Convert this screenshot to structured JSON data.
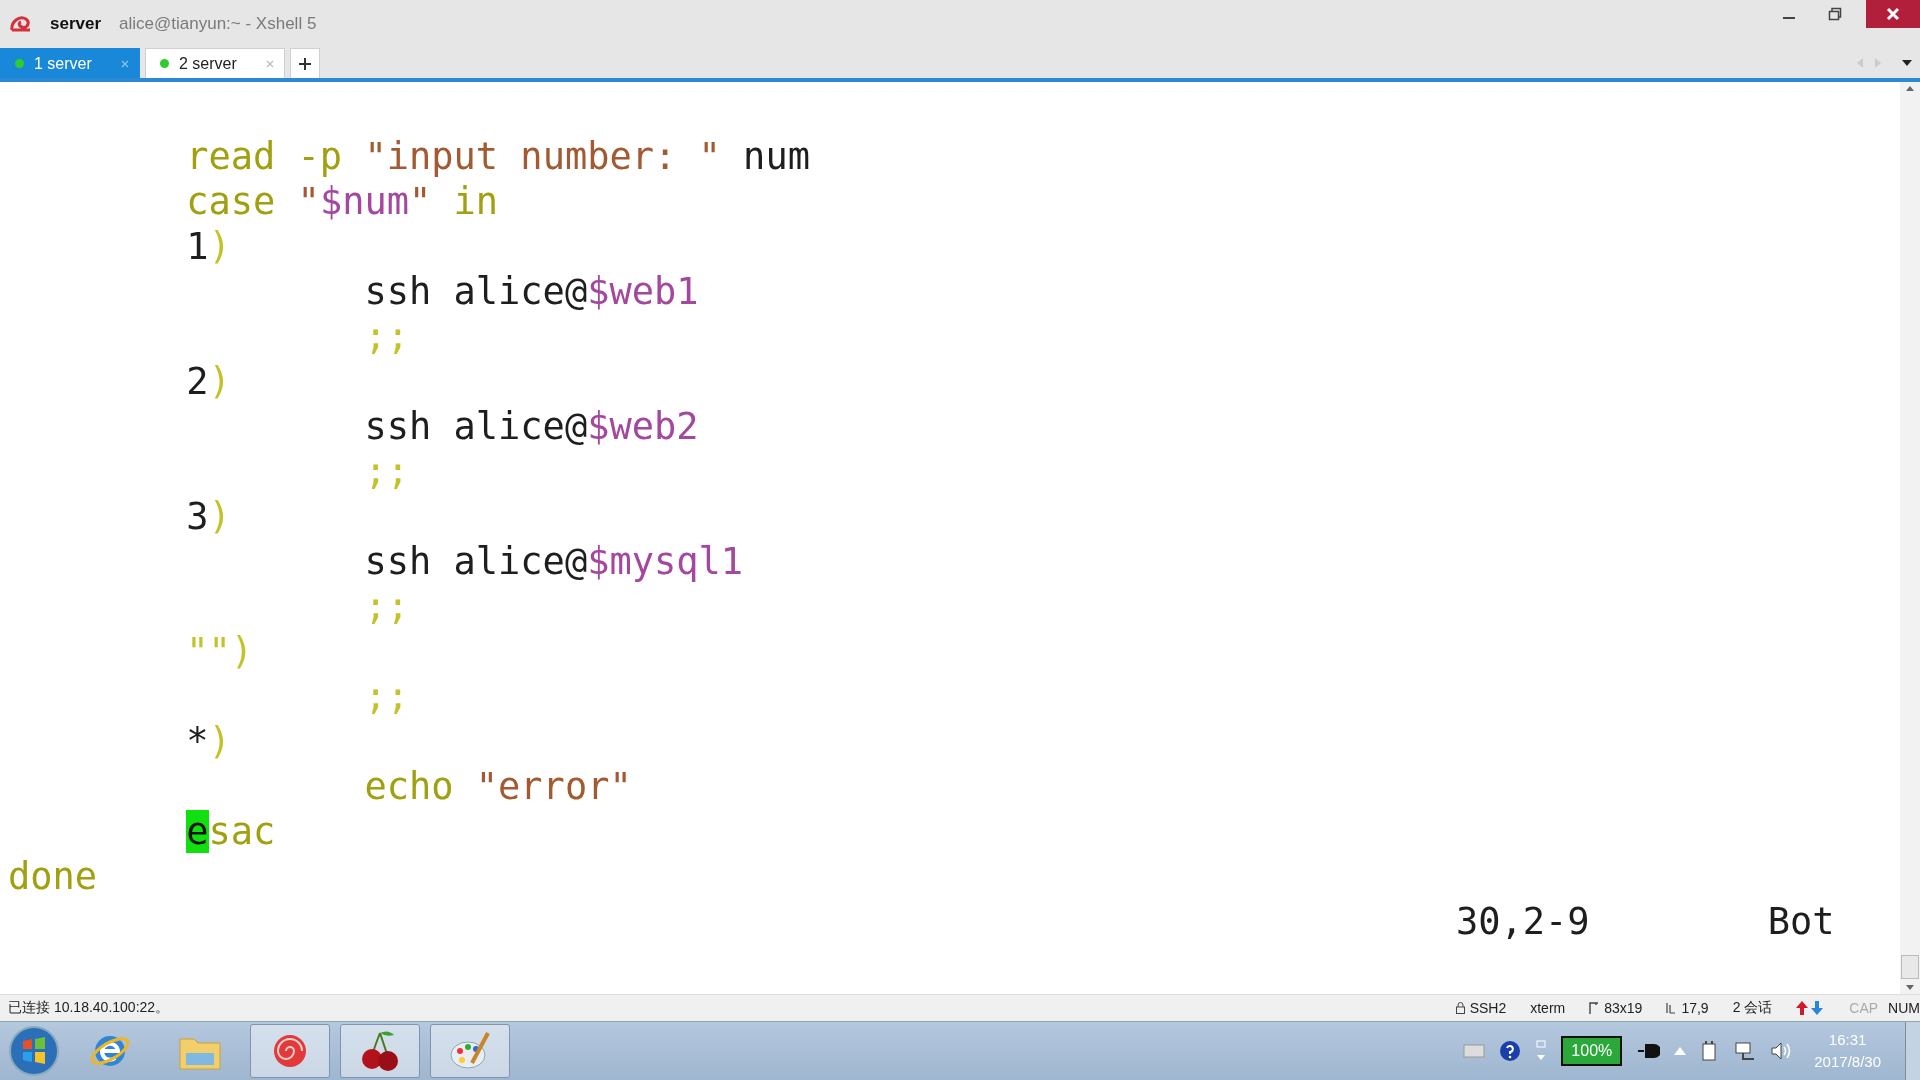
{
  "window": {
    "title": "server",
    "subtitle": "alice@tianyun:~ - Xshell 5"
  },
  "tabs": [
    {
      "label": "1 server",
      "selected": true,
      "connected": true
    },
    {
      "label": "2 server",
      "selected": false,
      "connected": true
    }
  ],
  "terminal": {
    "lines": [
      [
        {
          "text": "        read -p ",
          "kind": "keyword"
        },
        {
          "text": "\"input number: \"",
          "kind": "string"
        },
        {
          "text": " num",
          "kind": "plain"
        }
      ],
      [
        {
          "text": "        case ",
          "kind": "keyword"
        },
        {
          "text": "\"",
          "kind": "string"
        },
        {
          "text": "$num",
          "kind": "variable"
        },
        {
          "text": "\"",
          "kind": "string"
        },
        {
          "text": " in",
          "kind": "keyword"
        }
      ],
      [
        {
          "text": "        1",
          "kind": "plain"
        },
        {
          "text": ")",
          "kind": "delim"
        }
      ],
      [
        {
          "text": "                ssh alice@",
          "kind": "plain"
        },
        {
          "text": "$web1",
          "kind": "variable"
        }
      ],
      [
        {
          "text": "                ;;",
          "kind": "delim"
        }
      ],
      [
        {
          "text": "        2",
          "kind": "plain"
        },
        {
          "text": ")",
          "kind": "delim"
        }
      ],
      [
        {
          "text": "                ssh alice@",
          "kind": "plain"
        },
        {
          "text": "$web2",
          "kind": "variable"
        }
      ],
      [
        {
          "text": "                ;;",
          "kind": "delim"
        }
      ],
      [
        {
          "text": "        3",
          "kind": "plain"
        },
        {
          "text": ")",
          "kind": "delim"
        }
      ],
      [
        {
          "text": "                ssh alice@",
          "kind": "plain"
        },
        {
          "text": "$mysql1",
          "kind": "variable"
        }
      ],
      [
        {
          "text": "                ;;",
          "kind": "delim"
        }
      ],
      [
        {
          "text": "        \"\")",
          "kind": "delim"
        }
      ],
      [
        {
          "text": "                ;;",
          "kind": "delim"
        }
      ],
      [
        {
          "text": "        *",
          "kind": "plain"
        },
        {
          "text": ")",
          "kind": "delim"
        }
      ],
      [
        {
          "text": "                echo ",
          "kind": "keyword"
        },
        {
          "text": "\"error\"",
          "kind": "string"
        }
      ],
      [
        {
          "text": "        e",
          "kind": "keyword",
          "cursor": true
        },
        {
          "text": "sac",
          "kind": "keyword"
        }
      ],
      [
        {
          "text": "done",
          "kind": "keyword"
        }
      ]
    ],
    "ruler": {
      "position": "30,2-9",
      "scroll": "Bot"
    }
  },
  "status_bar": {
    "connection": "已连接 10.18.40.100:22。",
    "items": [
      {
        "text": "SSH2",
        "kind": "protocol"
      },
      {
        "text": "xterm",
        "kind": "terminal"
      },
      {
        "text": "83x19",
        "kind": "size"
      },
      {
        "text": "17,9",
        "kind": "position"
      },
      {
        "text": "2 会话",
        "kind": "sessions"
      }
    ],
    "keys": [
      {
        "text": "CAP",
        "on": false
      },
      {
        "text": "NUM",
        "on": true
      }
    ]
  },
  "taskbar": {
    "apps": [
      {
        "kind": "browser",
        "running": false
      },
      {
        "kind": "folder",
        "running": false
      },
      {
        "kind": "shell",
        "running": true
      },
      {
        "kind": "cherry",
        "running": true
      },
      {
        "kind": "paint",
        "running": true
      }
    ],
    "battery": "100%",
    "time": "16:31",
    "date": "2017/8/30"
  }
}
